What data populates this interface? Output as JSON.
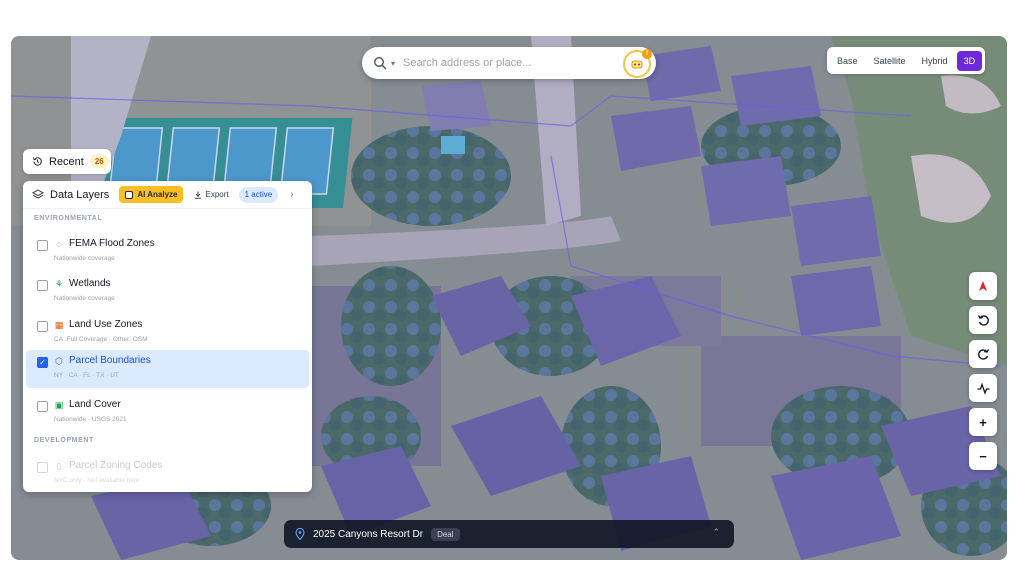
{
  "search": {
    "placeholder": "Search address or place...",
    "ai_badge": "!"
  },
  "map_types": {
    "items": [
      {
        "label": "Base",
        "active": false
      },
      {
        "label": "Satellite",
        "active": false
      },
      {
        "label": "Hybrid",
        "active": false
      },
      {
        "label": "3D",
        "active": true
      }
    ]
  },
  "recent": {
    "label": "Recent",
    "count": "26"
  },
  "layers_panel": {
    "title": "Data Layers",
    "ai_button": "AI Analyze",
    "export_button": "Export",
    "active_badge": "1 active",
    "sections": {
      "environmental": "ENVIRONMENTAL",
      "development": "DEVELOPMENT"
    },
    "layers": [
      {
        "name": "FEMA Flood Zones",
        "sub": "Nationwide coverage",
        "icon": "flood-icon",
        "checked": false,
        "disabled": false
      },
      {
        "name": "Wetlands",
        "sub": "Nationwide coverage",
        "icon": "plant-icon",
        "checked": false,
        "disabled": false
      },
      {
        "name": "Land Use Zones",
        "sub": "CA: Full Coverage · Other: OSM",
        "icon": "grid-icon",
        "checked": false,
        "disabled": false
      },
      {
        "name": "Parcel Boundaries",
        "sub": "NY · CA · FL · TX · UT",
        "icon": "box-icon",
        "checked": true,
        "disabled": false
      },
      {
        "name": "Land Cover",
        "sub": "Nationwide · USGS 2021",
        "icon": "image-icon",
        "checked": false,
        "disabled": false
      },
      {
        "name": "Parcel Zoning Codes",
        "sub": "NYC only · Not available here",
        "icon": "trash-icon",
        "checked": false,
        "disabled": true
      }
    ]
  },
  "map_controls": [
    "compass-icon",
    "rotate-left-icon",
    "rotate-right-icon",
    "activity-icon",
    "zoom-in-icon",
    "zoom-out-icon"
  ],
  "map_control_labels": {
    "zoom_in": "+",
    "zoom_out": "−"
  },
  "address_bar": {
    "address": "2025 Canyons Resort Dr",
    "tag": "Deal"
  },
  "colors": {
    "accent": "#6d28d9",
    "ai": "#fbbf24",
    "selected": "#dbeafe",
    "check": "#2563eb"
  }
}
